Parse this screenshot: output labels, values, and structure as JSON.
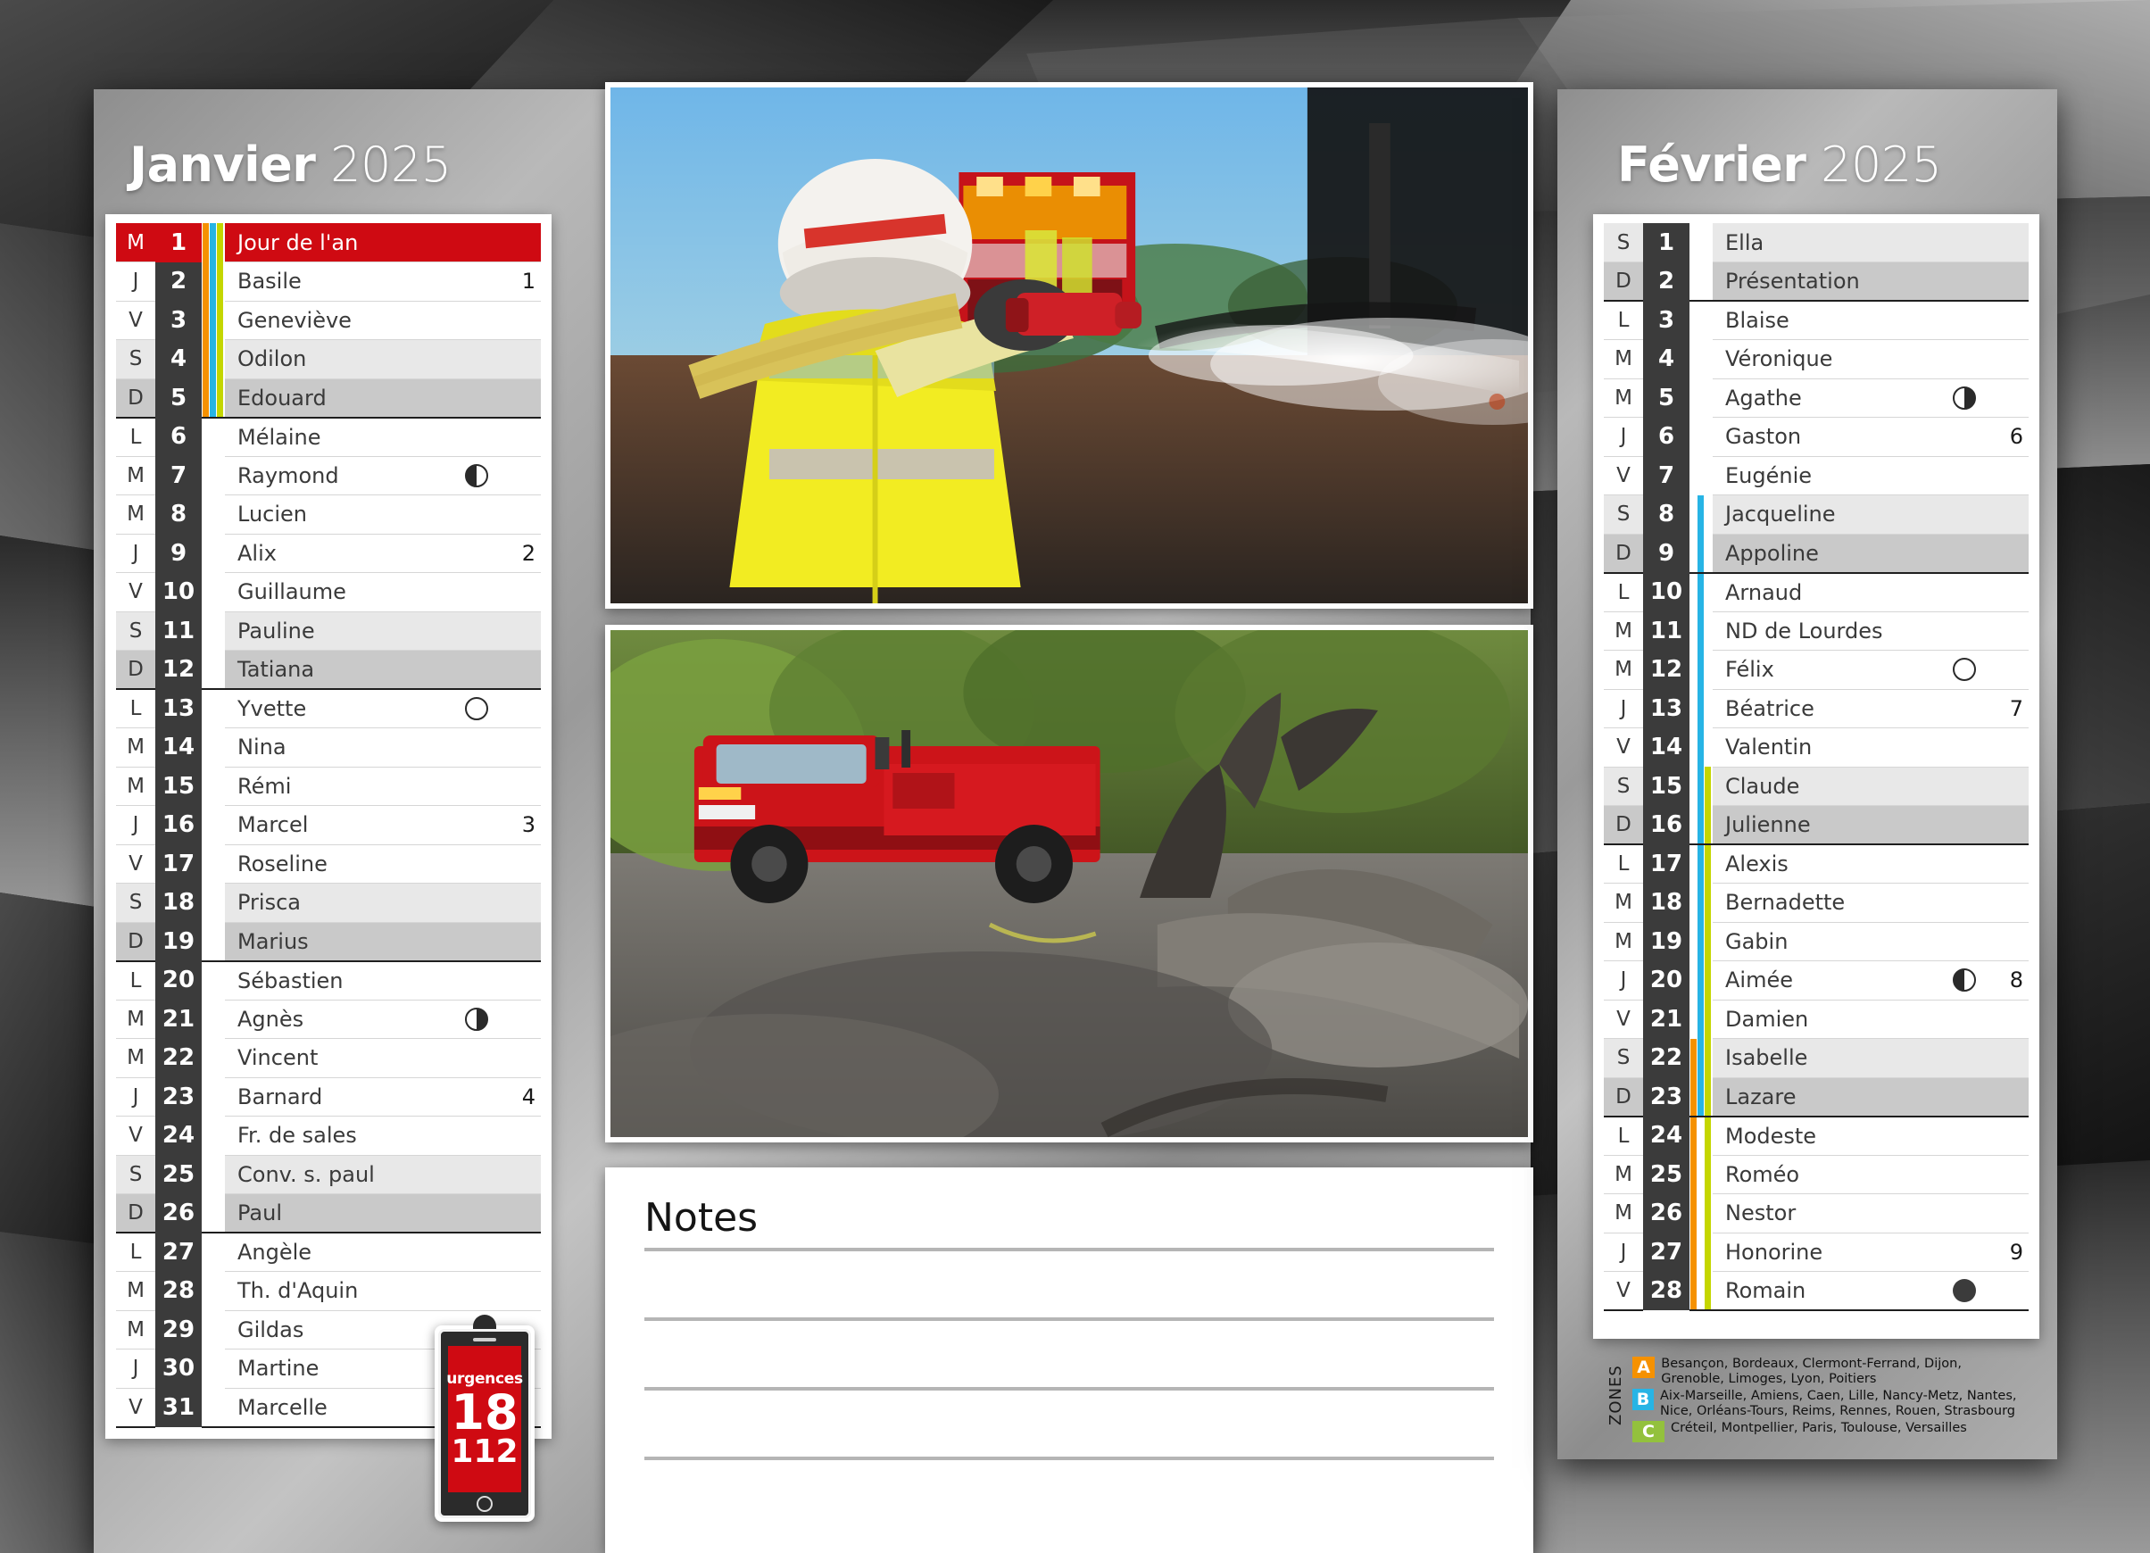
{
  "background": {
    "style": "dark-abstract-faceted"
  },
  "january": {
    "month_name": "Janvier",
    "year": "2025",
    "days": [
      {
        "dow": "M",
        "num": "1",
        "name": "Jour de l'an",
        "moon": "",
        "week": "",
        "type": "hol",
        "zones": [
          "a",
          "b",
          "c"
        ]
      },
      {
        "dow": "J",
        "num": "2",
        "name": "Basile",
        "moon": "",
        "week": "1",
        "type": "wd",
        "zones": [
          "a",
          "b",
          "c"
        ]
      },
      {
        "dow": "V",
        "num": "3",
        "name": "Geneviève",
        "moon": "",
        "week": "",
        "type": "wd",
        "zones": [
          "a",
          "b",
          "c"
        ]
      },
      {
        "dow": "S",
        "num": "4",
        "name": "Odilon",
        "moon": "",
        "week": "",
        "type": "sat",
        "zones": [
          "a",
          "b",
          "c"
        ]
      },
      {
        "dow": "D",
        "num": "5",
        "name": "Edouard",
        "moon": "",
        "week": "",
        "type": "sun",
        "zones": [
          "a",
          "b",
          "c"
        ]
      },
      {
        "dow": "L",
        "num": "6",
        "name": "Mélaine",
        "moon": "",
        "week": "",
        "type": "wd",
        "zones": []
      },
      {
        "dow": "M",
        "num": "7",
        "name": "Raymond",
        "moon": "last",
        "week": "",
        "type": "wd",
        "zones": []
      },
      {
        "dow": "M",
        "num": "8",
        "name": "Lucien",
        "moon": "",
        "week": "",
        "type": "wd",
        "zones": []
      },
      {
        "dow": "J",
        "num": "9",
        "name": "Alix",
        "moon": "",
        "week": "2",
        "type": "wd",
        "zones": []
      },
      {
        "dow": "V",
        "num": "10",
        "name": "Guillaume",
        "moon": "",
        "week": "",
        "type": "wd",
        "zones": []
      },
      {
        "dow": "S",
        "num": "11",
        "name": "Pauline",
        "moon": "",
        "week": "",
        "type": "sat",
        "zones": []
      },
      {
        "dow": "D",
        "num": "12",
        "name": "Tatiana",
        "moon": "",
        "week": "",
        "type": "sun",
        "zones": []
      },
      {
        "dow": "L",
        "num": "13",
        "name": "Yvette",
        "moon": "full",
        "week": "",
        "type": "wd",
        "zones": []
      },
      {
        "dow": "M",
        "num": "14",
        "name": "Nina",
        "moon": "",
        "week": "",
        "type": "wd",
        "zones": []
      },
      {
        "dow": "M",
        "num": "15",
        "name": "Rémi",
        "moon": "",
        "week": "",
        "type": "wd",
        "zones": []
      },
      {
        "dow": "J",
        "num": "16",
        "name": "Marcel",
        "moon": "",
        "week": "3",
        "type": "wd",
        "zones": []
      },
      {
        "dow": "V",
        "num": "17",
        "name": "Roseline",
        "moon": "",
        "week": "",
        "type": "wd",
        "zones": []
      },
      {
        "dow": "S",
        "num": "18",
        "name": "Prisca",
        "moon": "",
        "week": "",
        "type": "sat",
        "zones": []
      },
      {
        "dow": "D",
        "num": "19",
        "name": "Marius",
        "moon": "",
        "week": "",
        "type": "sun",
        "zones": []
      },
      {
        "dow": "L",
        "num": "20",
        "name": "Sébastien",
        "moon": "",
        "week": "",
        "type": "wd",
        "zones": []
      },
      {
        "dow": "M",
        "num": "21",
        "name": "Agnès",
        "moon": "first",
        "week": "",
        "type": "wd",
        "zones": []
      },
      {
        "dow": "M",
        "num": "22",
        "name": "Vincent",
        "moon": "",
        "week": "",
        "type": "wd",
        "zones": []
      },
      {
        "dow": "J",
        "num": "23",
        "name": "Barnard",
        "moon": "",
        "week": "4",
        "type": "wd",
        "zones": []
      },
      {
        "dow": "V",
        "num": "24",
        "name": "Fr. de sales",
        "moon": "",
        "week": "",
        "type": "wd",
        "zones": []
      },
      {
        "dow": "S",
        "num": "25",
        "name": "Conv. s. paul",
        "moon": "",
        "week": "",
        "type": "sat",
        "zones": []
      },
      {
        "dow": "D",
        "num": "26",
        "name": "Paul",
        "moon": "",
        "week": "",
        "type": "sun",
        "zones": []
      },
      {
        "dow": "L",
        "num": "27",
        "name": "Angèle",
        "moon": "",
        "week": "",
        "type": "wd",
        "zones": []
      },
      {
        "dow": "M",
        "num": "28",
        "name": "Th. d'Aquin",
        "moon": "",
        "week": "",
        "type": "wd",
        "zones": []
      },
      {
        "dow": "M",
        "num": "29",
        "name": "Gildas",
        "moon": "",
        "week": "",
        "type": "wd",
        "zones": []
      },
      {
        "dow": "J",
        "num": "30",
        "name": "Martine",
        "moon": "",
        "week": "",
        "type": "wd",
        "zones": []
      },
      {
        "dow": "V",
        "num": "31",
        "name": "Marcelle",
        "moon": "",
        "week": "",
        "type": "wd",
        "zones": []
      }
    ]
  },
  "february": {
    "month_name": "Février",
    "year": "2025",
    "days": [
      {
        "dow": "S",
        "num": "1",
        "name": "Ella",
        "moon": "",
        "week": "",
        "type": "sat",
        "zones": []
      },
      {
        "dow": "D",
        "num": "2",
        "name": "Présentation",
        "moon": "",
        "week": "",
        "type": "sun",
        "zones": []
      },
      {
        "dow": "L",
        "num": "3",
        "name": "Blaise",
        "moon": "",
        "week": "",
        "type": "wd",
        "zones": []
      },
      {
        "dow": "M",
        "num": "4",
        "name": "Véronique",
        "moon": "",
        "week": "",
        "type": "wd",
        "zones": []
      },
      {
        "dow": "M",
        "num": "5",
        "name": "Agathe",
        "moon": "first",
        "week": "",
        "type": "wd",
        "zones": []
      },
      {
        "dow": "J",
        "num": "6",
        "name": "Gaston",
        "moon": "",
        "week": "6",
        "type": "wd",
        "zones": []
      },
      {
        "dow": "V",
        "num": "7",
        "name": "Eugénie",
        "moon": "",
        "week": "",
        "type": "wd",
        "zones": []
      },
      {
        "dow": "S",
        "num": "8",
        "name": "Jacqueline",
        "moon": "",
        "week": "",
        "type": "sat",
        "zones": [
          "b"
        ]
      },
      {
        "dow": "D",
        "num": "9",
        "name": "Appoline",
        "moon": "",
        "week": "",
        "type": "sun",
        "zones": [
          "b"
        ]
      },
      {
        "dow": "L",
        "num": "10",
        "name": "Arnaud",
        "moon": "",
        "week": "",
        "type": "wd",
        "zones": [
          "b"
        ]
      },
      {
        "dow": "M",
        "num": "11",
        "name": "ND de Lourdes",
        "moon": "",
        "week": "",
        "type": "wd",
        "zones": [
          "b"
        ]
      },
      {
        "dow": "M",
        "num": "12",
        "name": "Félix",
        "moon": "full",
        "week": "",
        "type": "wd",
        "zones": [
          "b"
        ]
      },
      {
        "dow": "J",
        "num": "13",
        "name": "Béatrice",
        "moon": "",
        "week": "7",
        "type": "wd",
        "zones": [
          "b"
        ]
      },
      {
        "dow": "V",
        "num": "14",
        "name": "Valentin",
        "moon": "",
        "week": "",
        "type": "wd",
        "zones": [
          "b"
        ]
      },
      {
        "dow": "S",
        "num": "15",
        "name": "Claude",
        "moon": "",
        "week": "",
        "type": "sat",
        "zones": [
          "b",
          "c"
        ]
      },
      {
        "dow": "D",
        "num": "16",
        "name": "Julienne",
        "moon": "",
        "week": "",
        "type": "sun",
        "zones": [
          "b",
          "c"
        ]
      },
      {
        "dow": "L",
        "num": "17",
        "name": "Alexis",
        "moon": "",
        "week": "",
        "type": "wd",
        "zones": [
          "b",
          "c"
        ]
      },
      {
        "dow": "M",
        "num": "18",
        "name": "Bernadette",
        "moon": "",
        "week": "",
        "type": "wd",
        "zones": [
          "b",
          "c"
        ]
      },
      {
        "dow": "M",
        "num": "19",
        "name": "Gabin",
        "moon": "",
        "week": "",
        "type": "wd",
        "zones": [
          "b",
          "c"
        ]
      },
      {
        "dow": "J",
        "num": "20",
        "name": "Aimée",
        "moon": "last",
        "week": "8",
        "type": "wd",
        "zones": [
          "b",
          "c"
        ]
      },
      {
        "dow": "V",
        "num": "21",
        "name": "Damien",
        "moon": "",
        "week": "",
        "type": "wd",
        "zones": [
          "b",
          "c"
        ]
      },
      {
        "dow": "S",
        "num": "22",
        "name": "Isabelle",
        "moon": "",
        "week": "",
        "type": "sat",
        "zones": [
          "a",
          "b",
          "c"
        ]
      },
      {
        "dow": "D",
        "num": "23",
        "name": "Lazare",
        "moon": "",
        "week": "",
        "type": "sun",
        "zones": [
          "a",
          "b",
          "c"
        ]
      },
      {
        "dow": "L",
        "num": "24",
        "name": "Modeste",
        "moon": "",
        "week": "",
        "type": "wd",
        "zones": [
          "a",
          "c"
        ]
      },
      {
        "dow": "M",
        "num": "25",
        "name": "Roméo",
        "moon": "",
        "week": "",
        "type": "wd",
        "zones": [
          "a",
          "c"
        ]
      },
      {
        "dow": "M",
        "num": "26",
        "name": "Nestor",
        "moon": "",
        "week": "",
        "type": "wd",
        "zones": [
          "a",
          "c"
        ]
      },
      {
        "dow": "J",
        "num": "27",
        "name": "Honorine",
        "moon": "",
        "week": "9",
        "type": "wd",
        "zones": [
          "a",
          "c"
        ]
      },
      {
        "dow": "V",
        "num": "28",
        "name": "Romain",
        "moon": "new",
        "week": "",
        "type": "wd",
        "zones": [
          "a",
          "c"
        ]
      }
    ]
  },
  "notes": {
    "title": "Notes",
    "line_count": 4
  },
  "emergency": {
    "label": "urgences",
    "primary_number": "18",
    "secondary_number": "112"
  },
  "zones": {
    "label": "ZONES",
    "rows": [
      {
        "letter": "A",
        "color": "#f59100",
        "cities": "Besançon, Bordeaux, Clermont-Ferrand, Dijon, Grenoble, Limoges, Lyon, Poitiers"
      },
      {
        "letter": "B",
        "color": "#27b4e5",
        "cities": "Aix-Marseille, Amiens, Caen, Lille, Nancy-Metz, Nantes, Nice, Orléans-Tours, Reims, Rennes, Rouen, Strasbourg"
      },
      {
        "letter": "C",
        "color": "#93c13d",
        "cities": "Créteil, Montpellier, Paris, Toulouse, Versailles"
      }
    ]
  },
  "photos": [
    {
      "caption_semantic": "firefighter-hosing-down-burnt-ground"
    },
    {
      "caption_semantic": "fire-truck-on-burnt-hillside"
    }
  ]
}
